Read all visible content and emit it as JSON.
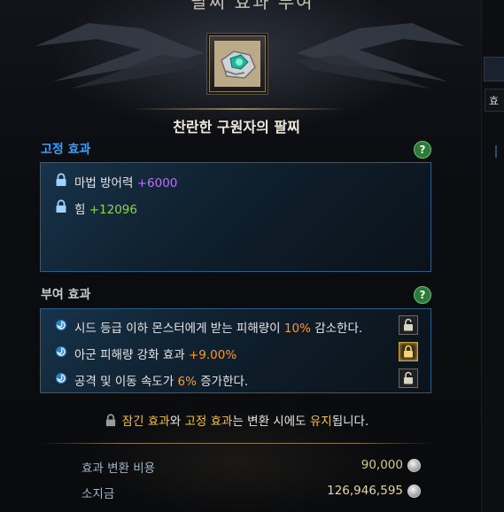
{
  "header": {
    "title_partial": "팔찌 효과 부여"
  },
  "side": {
    "tab_label": "효"
  },
  "item": {
    "name": "찬란한 구원자의 팔찌"
  },
  "fixed_effects": {
    "heading": "고정 효과",
    "heading_color": "#3aa0ff",
    "help": "?",
    "rows": [
      {
        "icon": "lock-icon",
        "label": "마법 방어력",
        "value": "+6000",
        "value_color": "#c26cff"
      },
      {
        "icon": "lock-icon",
        "label": "힘",
        "value": "+12096",
        "value_color": "#8fd64a"
      }
    ]
  },
  "given_effects": {
    "heading": "부여 효과",
    "heading_color": "#c9c9c9",
    "help": "?",
    "rows": [
      {
        "icon": "swirl-icon",
        "pre": "시드 등급 이하 몬스터에게 받는 피해량이 ",
        "highlight": "10%",
        "post": " 감소한다.",
        "locked": false
      },
      {
        "icon": "swirl-icon",
        "pre": "아군 피해량 강화 효과 ",
        "highlight": "+9.00%",
        "post": "",
        "locked": true
      },
      {
        "icon": "swirl-icon",
        "pre": "공격 및 이동 속도가 ",
        "highlight": "6%",
        "post": " 증가한다.",
        "locked": false
      }
    ]
  },
  "notice": {
    "part1": "잠긴 효과",
    "part2": "와 ",
    "part3": "고정 효과",
    "part4": "는 변환 시에도 ",
    "part5": "유지",
    "part6": "됩니다."
  },
  "costs": {
    "conversion_label": "효과 변환 비용",
    "conversion_value": "90,000",
    "conversion_color": "#d6c98a",
    "owned_label": "소지금",
    "owned_value": "126,946,595",
    "owned_color": "#e3d7a6",
    "currency_icon": "silver-coin-icon"
  }
}
